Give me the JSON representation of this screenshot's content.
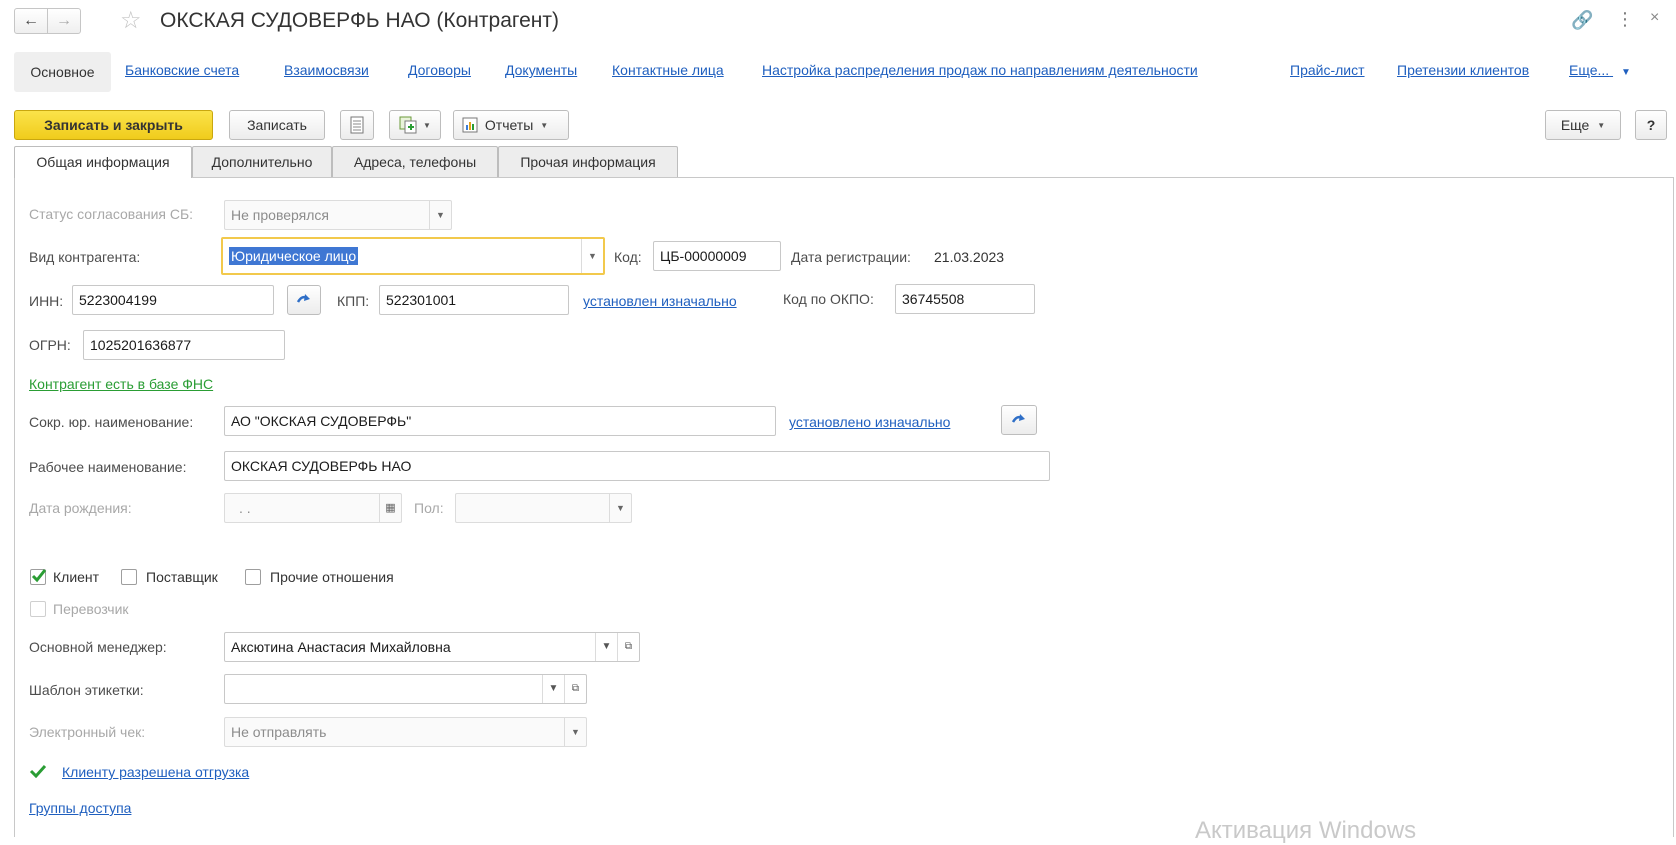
{
  "window": {
    "title": "ОКСКАЯ СУДОВЕРФЬ НАО (Контрагент)"
  },
  "nav": {
    "items": [
      {
        "label": "Основное"
      },
      {
        "label": "Банковские счета"
      },
      {
        "label": "Взаимосвязи"
      },
      {
        "label": "Договоры"
      },
      {
        "label": "Документы"
      },
      {
        "label": "Контактные лица"
      },
      {
        "label": "Настройка распределения продаж по направлениям деятельности"
      },
      {
        "label": "Прайс-лист"
      },
      {
        "label": "Претензии клиентов"
      },
      {
        "label": "Еще..."
      }
    ]
  },
  "toolbar": {
    "save_close": "Записать и закрыть",
    "save": "Записать",
    "reports": "Отчеты",
    "more": "Еще",
    "help": "?"
  },
  "tabs": [
    {
      "label": "Общая информация"
    },
    {
      "label": "Дополнительно"
    },
    {
      "label": "Адреса, телефоны"
    },
    {
      "label": "Прочая информация"
    }
  ],
  "form": {
    "sb_status": {
      "label": "Статус согласования СБ:",
      "value": "Не проверялся"
    },
    "kind": {
      "label": "Вид контрагента:",
      "value": "Юридическое лицо"
    },
    "code": {
      "label": "Код:",
      "value": "ЦБ-00000009"
    },
    "reg_date": {
      "label": "Дата регистрации:",
      "value": "21.03.2023"
    },
    "inn": {
      "label": "ИНН:",
      "value": "5223004199"
    },
    "kpp": {
      "label": "КПП:",
      "value": "522301001"
    },
    "kpp_status": "установлен изначально",
    "okpo": {
      "label": "Код по ОКПО:",
      "value": "36745508"
    },
    "ogrn": {
      "label": "ОГРН:",
      "value": "1025201636877"
    },
    "fns_link": "Контрагент есть в базе ФНС",
    "short_name": {
      "label": "Сокр. юр. наименование:",
      "value": "АО \"ОКСКАЯ СУДОВЕРФЬ\""
    },
    "short_name_status": "установлено изначально",
    "work_name": {
      "label": "Рабочее наименование:",
      "value": "ОКСКАЯ СУДОВЕРФЬ НАО"
    },
    "birth_date": {
      "label": "Дата рождения:",
      "value": " .  ."
    },
    "gender": {
      "label": "Пол:",
      "value": ""
    },
    "client": {
      "label": "Клиент",
      "checked": true
    },
    "supplier": {
      "label": "Поставщик",
      "checked": false
    },
    "other_rel": {
      "label": "Прочие отношения",
      "checked": false
    },
    "carrier": {
      "label": "Перевозчик",
      "checked": false
    },
    "manager": {
      "label": "Основной менеджер:",
      "value": "Аксютина Анастасия Михайловна"
    },
    "label_template": {
      "label": "Шаблон этикетки:",
      "value": ""
    },
    "e_receipt": {
      "label": "Электронный чек:",
      "value": "Не отправлять"
    },
    "shipment_link": "Клиенту разрешена отгрузка",
    "access_groups": "Группы доступа"
  },
  "watermark": "Активация Windows",
  "colors": {
    "accent_yellow": "#f5d426",
    "link_blue": "#1f5fbf",
    "link_green": "#2a9d34",
    "check_green": "#2a9d34",
    "focus_border": "#f2c94c"
  }
}
